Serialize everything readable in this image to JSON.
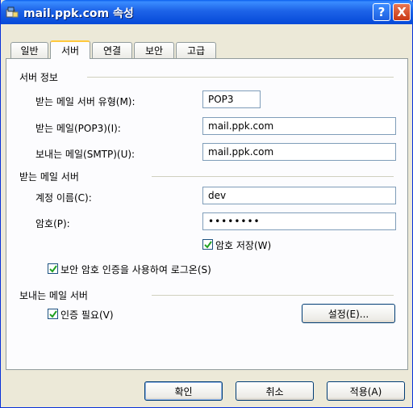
{
  "window": {
    "title": "mail.ppk.com 속성",
    "help_label": "?",
    "close_label": "X"
  },
  "tabs": [
    {
      "label": "일반",
      "active": false
    },
    {
      "label": "서버",
      "active": true
    },
    {
      "label": "연결",
      "active": false
    },
    {
      "label": "보안",
      "active": false
    },
    {
      "label": "고급",
      "active": false
    }
  ],
  "server_info": {
    "header": "서버 정보",
    "incoming_type_label": "받는 메일 서버 유형(M):",
    "incoming_type_value": "POP3",
    "incoming_label": "받는 메일(POP3)(I):",
    "incoming_value": "mail.ppk.com",
    "outgoing_label": "보내는 메일(SMTP)(U):",
    "outgoing_value": "mail.ppk.com"
  },
  "incoming_server": {
    "header": "받는 메일 서버",
    "account_label": "계정 이름(C):",
    "account_value": "dev",
    "password_label": "암호(P):",
    "password_value": "••••••••",
    "remember_password_label": "암호 저장(W)",
    "remember_password_checked": true,
    "spa_label": "보안 암호 인증을 사용하여 로그온(S)",
    "spa_checked": true
  },
  "outgoing_server": {
    "header": "보내는 메일 서버",
    "auth_required_label": "인증 필요(V)",
    "auth_required_checked": true,
    "settings_button": "설정(E)..."
  },
  "buttons": {
    "ok": "확인",
    "cancel": "취소",
    "apply": "적용(A)"
  }
}
